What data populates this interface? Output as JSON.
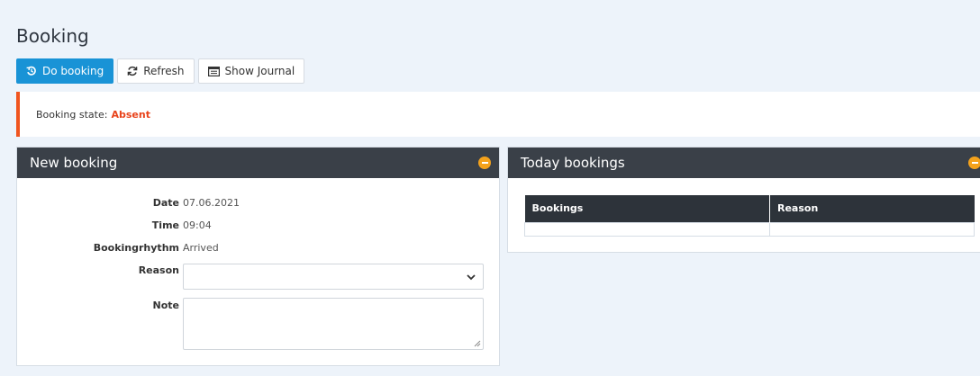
{
  "page": {
    "title": "Booking"
  },
  "toolbar": {
    "do_booking_label": "Do booking",
    "refresh_label": "Refresh",
    "show_journal_label": "Show Journal"
  },
  "alert": {
    "label": "Booking state:",
    "state": "Absent",
    "state_color": "#e8431b",
    "border_color": "#f0541e"
  },
  "new_booking": {
    "title": "New booking",
    "fields": {
      "date": {
        "label": "Date",
        "value": "07.06.2021"
      },
      "time": {
        "label": "Time",
        "value": "09:04"
      },
      "rhythm": {
        "label": "Bookingrhythm",
        "value": "Arrived"
      },
      "reason": {
        "label": "Reason",
        "value": ""
      },
      "note": {
        "label": "Note",
        "value": ""
      }
    }
  },
  "today_bookings": {
    "title": "Today bookings",
    "columns": [
      "Bookings",
      "Reason"
    ],
    "rows": []
  },
  "colors": {
    "primary": "#1993d6",
    "panel_header": "#3a4048",
    "collapse_dot": "#f4a21c",
    "background": "#edf3fa"
  },
  "icons": {
    "do_booking": "history-icon",
    "refresh": "refresh-icon",
    "show_journal": "journal-icon",
    "collapse": "collapse-icon",
    "select_arrow": "chevron-down-icon"
  }
}
